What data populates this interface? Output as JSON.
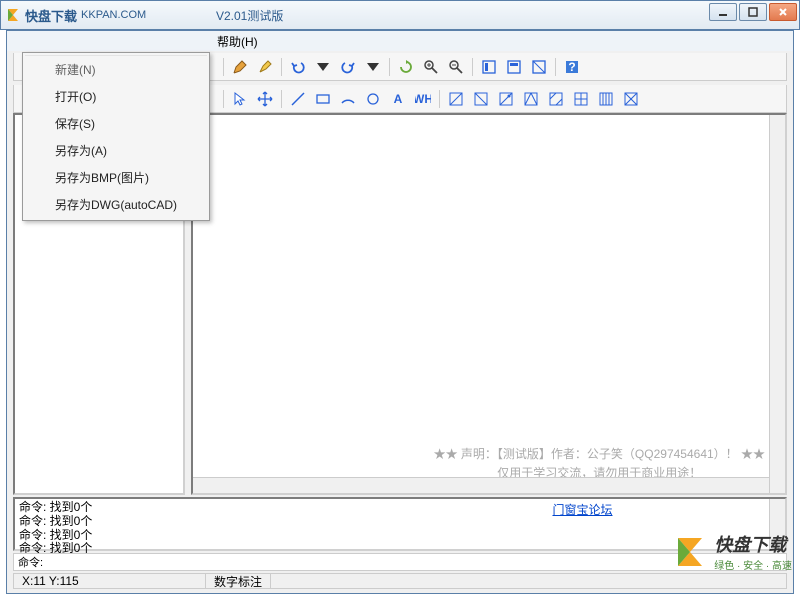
{
  "titlebar": {
    "app_name": "快盘下载",
    "url": "KKPAN.COM",
    "version": "V2.01测试版"
  },
  "menubar": {
    "help": "帮助(H)"
  },
  "file_menu": {
    "items": [
      "新建(N)",
      "打开(O)",
      "保存(S)",
      "另存为(A)",
      "另存为BMP(图片)",
      "另存为DWG(autoCAD)"
    ]
  },
  "canvas": {
    "note_line1": "★★ 声明：【测试版】作者：公子笑（QQ297454641）！ ★★",
    "note_line2": "仅用于学习交流，请勿用于商业用途！"
  },
  "log": {
    "lines": [
      "命令: 找到0个",
      "命令: 找到0个",
      "命令: 找到0个",
      "命令: 找到0个"
    ],
    "link": "门窗宝论坛"
  },
  "cmd": {
    "label": "命令:"
  },
  "status": {
    "coords": "X:11  Y:115",
    "mode": "数字标注"
  },
  "watermark": {
    "big": "快盘下载",
    "small": "绿色 · 安全 · 高速"
  }
}
